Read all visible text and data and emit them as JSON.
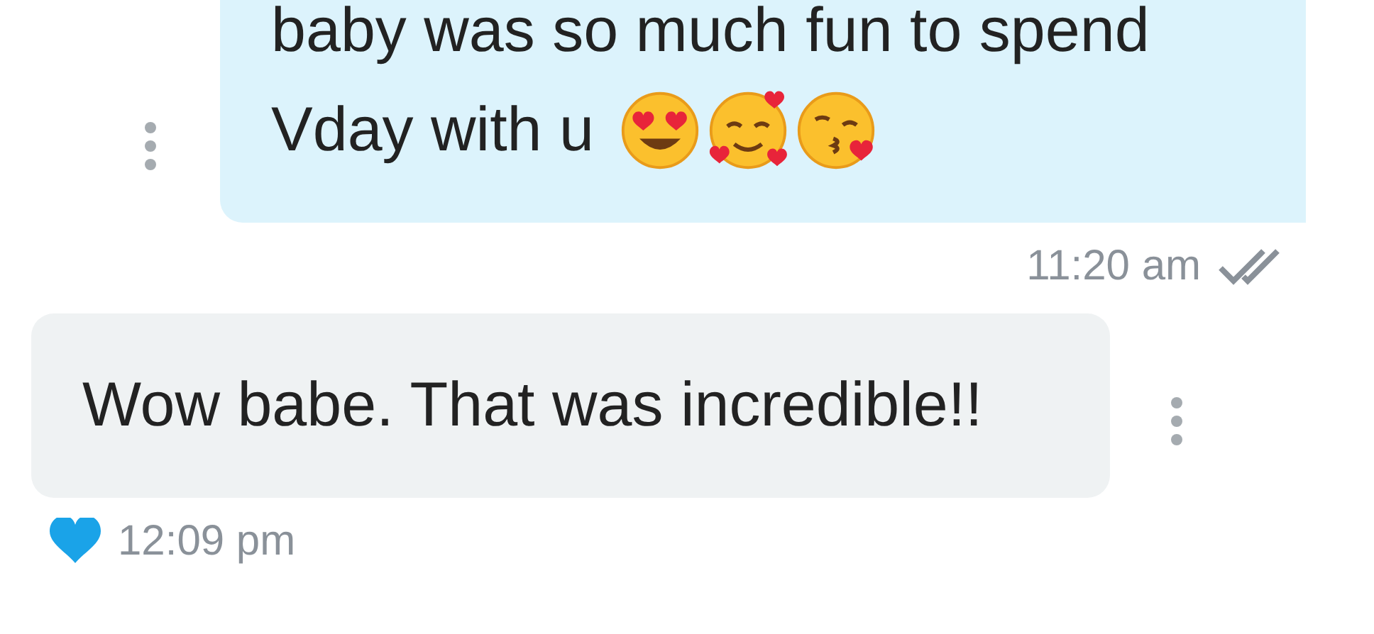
{
  "messages": [
    {
      "kind": "outgoing",
      "lines": [
        "baby was so much fun to spend",
        "Vday with u"
      ],
      "time": "11:20 am",
      "read": true
    },
    {
      "kind": "incoming",
      "lines": [
        "Wow babe. That was incredible!!"
      ],
      "time": "12:09 pm",
      "liked": true
    }
  ]
}
